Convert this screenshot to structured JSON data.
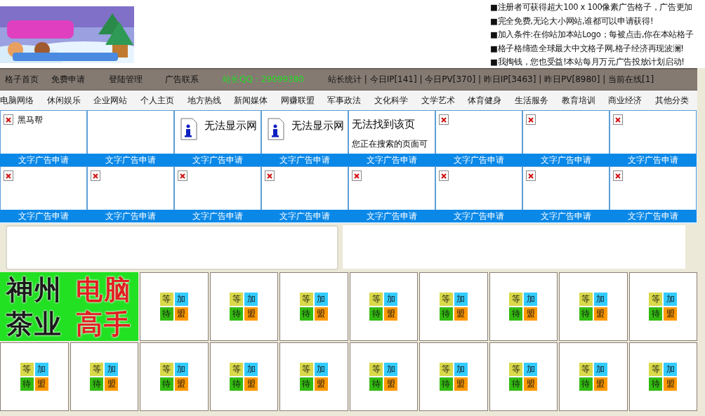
{
  "header": {
    "notices": [
      "■注册者可获得超大100 x 100像素广告格子，广告更加",
      "■完全免费,无论大小网站,谁都可以申请获得!",
      "■加入条件:在你站加本站Logo；每被点击,你在本站格子",
      "■格子格缔造全球最大中文格子网,格子经济再现波澜!",
      "■我掏钱，您也受益!本站每月万元广告投放计划启动!"
    ]
  },
  "nav": {
    "links": [
      "格子首页",
      "免费申请",
      "登陆管理",
      "广告联系"
    ],
    "qq": "站长QQ：29099380",
    "stats": "站长统计 | 今日IP[141] | 今日PV[370] | 昨日IP[3463] | 昨日PV[8980] | 当前在线[1]"
  },
  "categories": [
    "电脑网络",
    "休闲娱乐",
    "企业网站",
    "个人主页",
    "地方热线",
    "新闻媒体",
    "网赚联盟",
    "军事政法",
    "文化科学",
    "文学艺术",
    "体育健身",
    "生活服务",
    "教育培训",
    "商业经济",
    "其他分类"
  ],
  "text_ads": [
    {
      "kind": "broken-image",
      "text": "黑马帮",
      "label": "文字广告申请"
    },
    {
      "kind": "empty",
      "label": "文字广告申请"
    },
    {
      "kind": "info-error",
      "title": "无法显示网",
      "label": "文字广告申请"
    },
    {
      "kind": "info-error",
      "title": "无法显示网",
      "label": "文字广告申请"
    },
    {
      "kind": "not-found",
      "title": "无法找到该页",
      "text": "您正在搜索的页面可",
      "label": "文字广告申请"
    },
    {
      "kind": "broken-image",
      "label": "文字广告申请"
    },
    {
      "kind": "broken-image",
      "label": "文字广告申请"
    },
    {
      "kind": "broken-image",
      "label": "文字广告申请"
    },
    {
      "kind": "broken-image",
      "label": "文字广告申请"
    },
    {
      "kind": "broken-image",
      "label": "文字广告申请"
    },
    {
      "kind": "broken-image",
      "label": "文字广告申请"
    },
    {
      "kind": "broken-image",
      "label": "文字广告申请"
    },
    {
      "kind": "broken-image",
      "label": "文字广告申请"
    },
    {
      "kind": "broken-image",
      "label": "文字广告申请"
    },
    {
      "kind": "broken-image",
      "label": "文字广告申请"
    },
    {
      "kind": "broken-image",
      "label": "文字广告申请"
    }
  ],
  "banner": {
    "words": [
      {
        "text": "神州",
        "color": "#1a1a1a"
      },
      {
        "text": "电脑",
        "color": "#e02020"
      },
      {
        "text": "茶业",
        "color": "#1a1a1a"
      },
      {
        "text": "高手",
        "color": "#e02020"
      }
    ]
  },
  "slots": [
    {
      "tiles": [
        {
          "text": "等",
          "color": "#d9d94a"
        },
        {
          "text": "加",
          "color": "#33ccff"
        },
        {
          "text": "待",
          "color": "#33bb11"
        },
        {
          "text": "盟",
          "color": "#ff9900"
        }
      ]
    },
    {
      "tiles": [
        {
          "text": "等",
          "color": "#d9d94a"
        },
        {
          "text": "加",
          "color": "#33ccff"
        },
        {
          "text": "待",
          "color": "#33bb11"
        },
        {
          "text": "盟",
          "color": "#ff9900"
        }
      ]
    },
    {
      "tiles": [
        {
          "text": "等",
          "color": "#d9d94a"
        },
        {
          "text": "加",
          "color": "#33ccff"
        },
        {
          "text": "待",
          "color": "#33bb11"
        },
        {
          "text": "盟",
          "color": "#ff9900"
        }
      ]
    },
    {
      "tiles": [
        {
          "text": "等",
          "color": "#d9d94a"
        },
        {
          "text": "加",
          "color": "#33ccff"
        },
        {
          "text": "待",
          "color": "#33bb11"
        },
        {
          "text": "盟",
          "color": "#ff9900"
        }
      ]
    },
    {
      "tiles": [
        {
          "text": "等",
          "color": "#d9d94a"
        },
        {
          "text": "加",
          "color": "#33ccff"
        },
        {
          "text": "待",
          "color": "#33bb11"
        },
        {
          "text": "盟",
          "color": "#ff9900"
        }
      ]
    },
    {
      "tiles": [
        {
          "text": "等",
          "color": "#d9d94a"
        },
        {
          "text": "加",
          "color": "#33ccff"
        },
        {
          "text": "待",
          "color": "#33bb11"
        },
        {
          "text": "盟",
          "color": "#ff9900"
        }
      ]
    },
    {
      "tiles": [
        {
          "text": "等",
          "color": "#d9d94a"
        },
        {
          "text": "加",
          "color": "#33ccff"
        },
        {
          "text": "待",
          "color": "#33bb11"
        },
        {
          "text": "盟",
          "color": "#ff9900"
        }
      ]
    },
    {
      "tiles": [
        {
          "text": "等",
          "color": "#d9d94a"
        },
        {
          "text": "加",
          "color": "#33ccff"
        },
        {
          "text": "待",
          "color": "#33bb11"
        },
        {
          "text": "盟",
          "color": "#ff9900"
        }
      ]
    },
    {
      "tiles": [
        {
          "text": "等",
          "color": "#d9d94a"
        },
        {
          "text": "加",
          "color": "#33ccff"
        },
        {
          "text": "待",
          "color": "#33bb11"
        },
        {
          "text": "盟",
          "color": "#ff9900"
        }
      ]
    },
    {
      "tiles": [
        {
          "text": "等",
          "color": "#d9d94a"
        },
        {
          "text": "加",
          "color": "#33ccff"
        },
        {
          "text": "待",
          "color": "#33bb11"
        },
        {
          "text": "盟",
          "color": "#ff9900"
        }
      ]
    },
    {
      "tiles": [
        {
          "text": "等",
          "color": "#d9d94a"
        },
        {
          "text": "加",
          "color": "#33ccff"
        },
        {
          "text": "待",
          "color": "#33bb11"
        },
        {
          "text": "盟",
          "color": "#ff9900"
        }
      ]
    },
    {
      "tiles": [
        {
          "text": "等",
          "color": "#d9d94a"
        },
        {
          "text": "加",
          "color": "#33ccff"
        },
        {
          "text": "待",
          "color": "#33bb11"
        },
        {
          "text": "盟",
          "color": "#ff9900"
        }
      ]
    },
    {
      "tiles": [
        {
          "text": "等",
          "color": "#d9d94a"
        },
        {
          "text": "加",
          "color": "#33ccff"
        },
        {
          "text": "待",
          "color": "#33bb11"
        },
        {
          "text": "盟",
          "color": "#ff9900"
        }
      ]
    },
    {
      "tiles": [
        {
          "text": "等",
          "color": "#d9d94a"
        },
        {
          "text": "加",
          "color": "#33ccff"
        },
        {
          "text": "待",
          "color": "#33bb11"
        },
        {
          "text": "盟",
          "color": "#ff9900"
        }
      ]
    },
    {
      "tiles": [
        {
          "text": "等",
          "color": "#d9d94a"
        },
        {
          "text": "加",
          "color": "#33ccff"
        },
        {
          "text": "待",
          "color": "#33bb11"
        },
        {
          "text": "盟",
          "color": "#ff9900"
        }
      ]
    },
    {
      "tiles": [
        {
          "text": "等",
          "color": "#d9d94a"
        },
        {
          "text": "加",
          "color": "#33ccff"
        },
        {
          "text": "待",
          "color": "#33bb11"
        },
        {
          "text": "盟",
          "color": "#ff9900"
        }
      ]
    },
    {
      "tiles": [
        {
          "text": "等",
          "color": "#d9d94a"
        },
        {
          "text": "加",
          "color": "#33ccff"
        },
        {
          "text": "待",
          "color": "#33bb11"
        },
        {
          "text": "盟",
          "color": "#ff9900"
        }
      ]
    },
    {
      "tiles": [
        {
          "text": "等",
          "color": "#d9d94a"
        },
        {
          "text": "加",
          "color": "#33ccff"
        },
        {
          "text": "待",
          "color": "#33bb11"
        },
        {
          "text": "盟",
          "color": "#ff9900"
        }
      ]
    }
  ]
}
